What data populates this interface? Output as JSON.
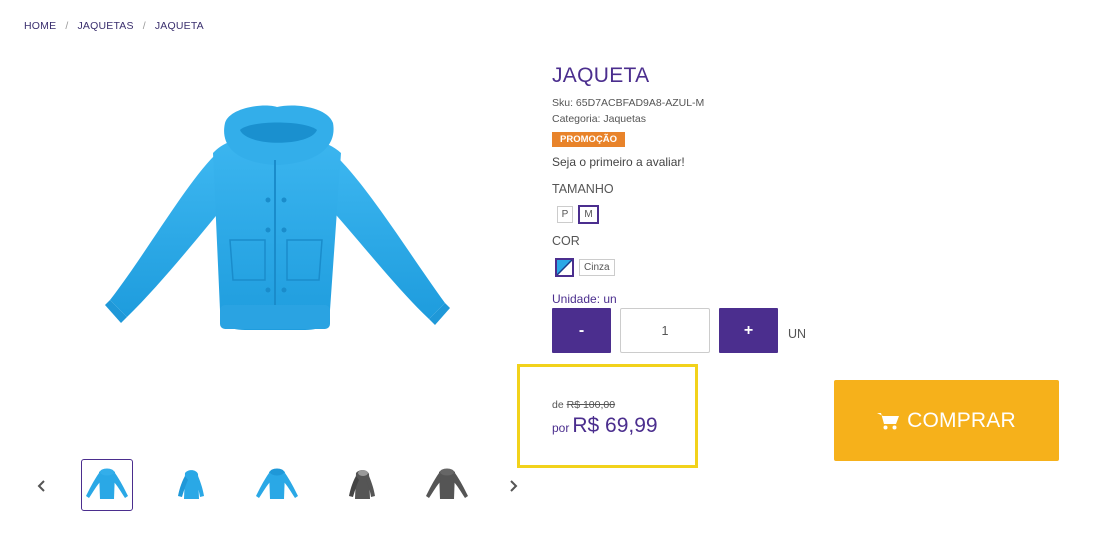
{
  "breadcrumb": {
    "items": [
      "HOME",
      "JAQUETAS",
      "JAQUETA"
    ],
    "separator": "/"
  },
  "product": {
    "title": "JAQUETA",
    "sku": "Sku: 65D7ACBFAD9A8-AZUL-M",
    "category": "Categoria: Jaquetas",
    "badge": "PROMOÇÃO",
    "review_text": "Seja o primeiro a avaliar!"
  },
  "size": {
    "label": "TAMANHO",
    "options": [
      "P",
      "M"
    ],
    "selected": "M"
  },
  "color": {
    "label": "COR",
    "selected_name": "Cinza"
  },
  "quantity": {
    "unit_label": "Unidade: un",
    "minus": "-",
    "plus": "+",
    "value": "1",
    "unit_suffix": "UN"
  },
  "price": {
    "de_label": "de",
    "old": "R$ 100,00",
    "por_label": "por",
    "new": "R$ 69,99"
  },
  "buy": {
    "label": "COMPRAR",
    "icon": "cart-icon"
  },
  "thumbnails": {
    "prev_icon": "chevron-left-icon",
    "next_icon": "chevron-right-icon",
    "count": 5
  },
  "colors": {
    "accent": "#4b2e8e",
    "buy": "#f6b11b",
    "badge": "#e8832a",
    "highlight": "#f2d21b",
    "jacket_blue": "#2aa8e6",
    "jacket_gray": "#555555"
  }
}
